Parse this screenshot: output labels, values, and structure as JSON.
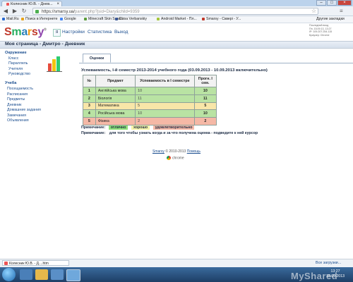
{
  "browser": {
    "tab_title": "Колесник Ю.В. - Днев...",
    "url_base": "https://smarsy.ua/",
    "url_path": "parent.php?jsid=Diary&child=9359",
    "bookmarks": [
      {
        "label": "Mail.Ru",
        "color": "#2a6ad0"
      },
      {
        "label": "Поиск в Интернете",
        "color": "#e8a317"
      },
      {
        "label": "Google",
        "color": "#4285f4"
      },
      {
        "label": "Minecraft Skin Searc...",
        "color": "#5a9c3a"
      },
      {
        "label": "Dima Verbanskiy",
        "color": "#3b5998"
      },
      {
        "label": "Android Market - Пл...",
        "color": "#a4c639"
      },
      {
        "label": "Smarsy - Сквері - У...",
        "color": "#c0392b"
      }
    ],
    "other_bookmarks": "Другие закладки"
  },
  "site": {
    "logo_letters": [
      "S",
      "m",
      "a",
      "r",
      "s",
      "y"
    ],
    "logo_reg": "®",
    "user_badge": "Я",
    "nav": [
      "Настройки",
      "Статистика",
      "Выход"
    ],
    "last_login": [
      "Последний вход",
      "Пн, 15.09.13, 13:27",
      "IP: 109.207.254.115",
      "Браузер: Chrome"
    ],
    "page_title": "Моя страница - Дмитро - Дневник"
  },
  "sidebar": {
    "section1_title": "Окружение",
    "section1_items": [
      "Класс",
      "Параллель",
      "Учителя",
      "Руководство"
    ],
    "section2_title": "Учеба",
    "section2_items": [
      "Посещаемость",
      "Расписания",
      "Предметы",
      "Дневник",
      "Домашние задания",
      "Замечания",
      "Объявления"
    ]
  },
  "main": {
    "tab_label": "Оценки",
    "performance_title": "Успеваемость, I-й семестр 2013-2014 учебного года (03.09.2013 - 10.09.2013 включительно)",
    "table": {
      "headers": [
        "№",
        "Предмет",
        "Успеваемость в I семестре",
        "Прогн. I сем."
      ],
      "rows": [
        {
          "num": "1",
          "subject": "Англійська мова",
          "grades": "10",
          "forecast": "10",
          "status": "good"
        },
        {
          "num": "2",
          "subject": "Біологія",
          "grades": "11",
          "forecast": "11",
          "status": "good"
        },
        {
          "num": "3",
          "subject": "Математика",
          "grades": "5",
          "forecast": "5",
          "status": "satisfactory"
        },
        {
          "num": "4",
          "subject": "Російська мова",
          "grades": "10",
          "forecast": "10",
          "status": "good"
        },
        {
          "num": "5",
          "subject": "Фізика",
          "grades": "2",
          "forecast": "2",
          "status": "bad"
        }
      ]
    },
    "note_label": "Примечание:",
    "legend": [
      {
        "label": "отлично",
        "color": "#8fe07a"
      },
      {
        "label": "хорошо",
        "color": "#f6f3a8"
      },
      {
        "label": "удовлетворительно",
        "color": "#f5b9a8"
      }
    ],
    "note2_text": "для того чтобы узнать когда и за что получена оценка - подведите к ней курсор"
  },
  "colors": {
    "good": "#b9e3a3",
    "satisfactory": "#f8e6a8",
    "bad": "#f5b8a6"
  },
  "footer": {
    "brand_link": "Smarsy",
    "copyright": "© 2010-2013",
    "help_link": "Помощь",
    "chrome_label": "chrome"
  },
  "downloads": {
    "item": "Колесник Ю.В. - Д....htm",
    "show_all": "Все загрузки..."
  },
  "taskbar": {
    "watermark": "MyShared",
    "clock_time": "13:27",
    "clock_date": "15.09.2013"
  }
}
